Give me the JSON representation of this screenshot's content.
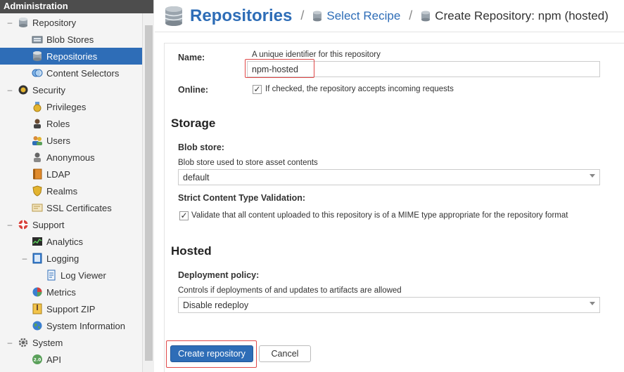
{
  "sidebar": {
    "title": "Administration",
    "items": [
      {
        "label": "Repository",
        "icon": "database-icon",
        "toggle": "–"
      },
      {
        "label": "Blob Stores",
        "icon": "blob-store-icon",
        "toggle": ""
      },
      {
        "label": "Repositories",
        "icon": "database-icon",
        "toggle": "",
        "selected": true
      },
      {
        "label": "Content Selectors",
        "icon": "content-selector-icon",
        "toggle": ""
      },
      {
        "label": "Security",
        "icon": "security-badge-icon",
        "toggle": "–"
      },
      {
        "label": "Privileges",
        "icon": "medal-icon",
        "toggle": ""
      },
      {
        "label": "Roles",
        "icon": "role-user-icon",
        "toggle": ""
      },
      {
        "label": "Users",
        "icon": "users-icon",
        "toggle": ""
      },
      {
        "label": "Anonymous",
        "icon": "anonymous-user-icon",
        "toggle": ""
      },
      {
        "label": "LDAP",
        "icon": "ldap-book-icon",
        "toggle": ""
      },
      {
        "label": "Realms",
        "icon": "shield-icon",
        "toggle": ""
      },
      {
        "label": "SSL Certificates",
        "icon": "certificate-icon",
        "toggle": ""
      },
      {
        "label": "Support",
        "icon": "lifebuoy-icon",
        "toggle": "–"
      },
      {
        "label": "Analytics",
        "icon": "analytics-chart-icon",
        "toggle": ""
      },
      {
        "label": "Logging",
        "icon": "logging-book-icon",
        "toggle": "–"
      },
      {
        "label": "Log Viewer",
        "icon": "log-page-icon",
        "toggle": ""
      },
      {
        "label": "Metrics",
        "icon": "pie-chart-icon",
        "toggle": ""
      },
      {
        "label": "Support ZIP",
        "icon": "zip-file-icon",
        "toggle": ""
      },
      {
        "label": "System Information",
        "icon": "globe-icon",
        "toggle": ""
      },
      {
        "label": "System",
        "icon": "gear-icon",
        "toggle": "–"
      },
      {
        "label": "API",
        "icon": "api-badge-icon",
        "toggle": ""
      }
    ]
  },
  "header": {
    "title": "Repositories",
    "separator": "/",
    "crumb1": "Select Recipe",
    "crumb2": "Create Repository: npm (hosted)"
  },
  "form": {
    "name_label": "Name:",
    "name_help": "A unique identifier for this repository",
    "name_value": "npm-hosted",
    "online_label": "Online:",
    "online_check": "✓",
    "online_help": "If checked, the repository accepts incoming requests",
    "storage_title": "Storage",
    "blob_label": "Blob store:",
    "blob_help": "Blob store used to store asset contents",
    "blob_value": "default",
    "strict_label": "Strict Content Type Validation:",
    "strict_check": "✓",
    "strict_help": "Validate that all content uploaded to this repository is of a MIME type appropriate for the repository format",
    "hosted_title": "Hosted",
    "deploy_label": "Deployment policy:",
    "deploy_help": "Controls if deployments of and updates to artifacts are allowed",
    "deploy_value": "Disable redeploy",
    "create_label": "Create repository",
    "cancel_label": "Cancel"
  },
  "colors": {
    "accent": "#2e6db7",
    "selected_bg": "#2e6db7",
    "highlight": "#e04848",
    "sidebar_header": "#4d4d4d"
  }
}
